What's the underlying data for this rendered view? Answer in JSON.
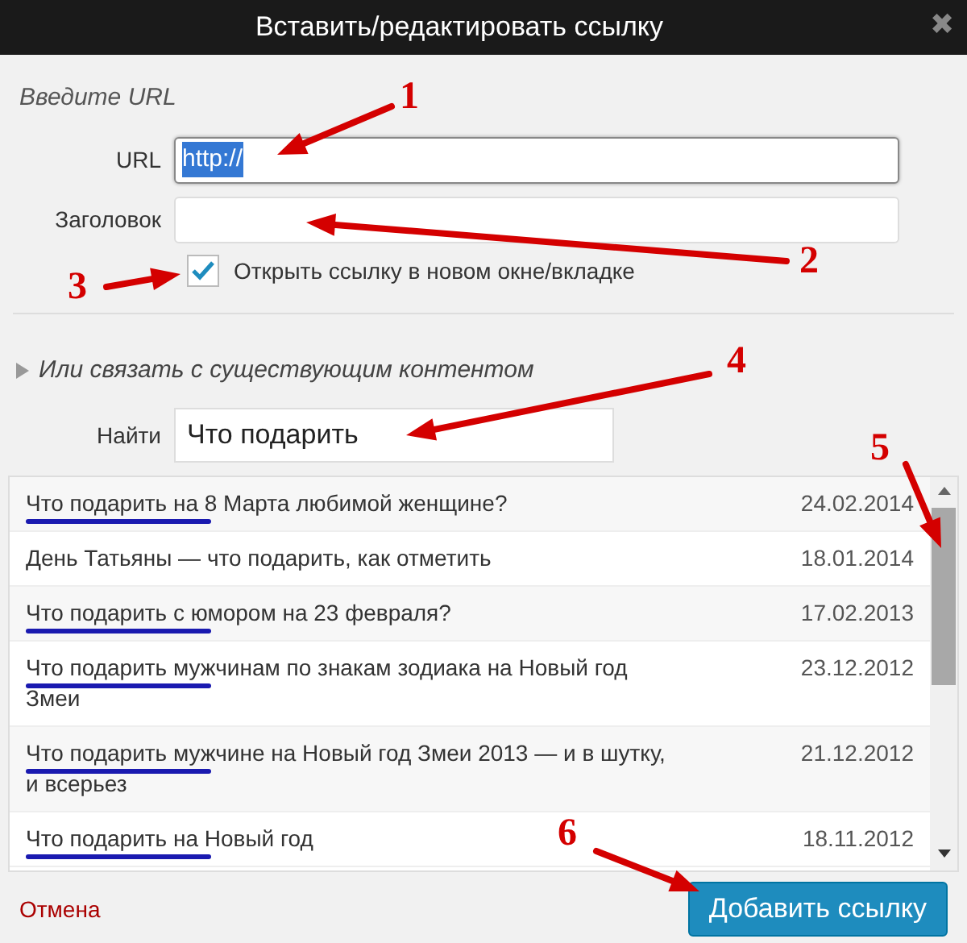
{
  "window": {
    "title": "Вставить/редактировать ссылку",
    "close": "✖"
  },
  "url_section": {
    "heading": "Введите URL",
    "url_label": "URL",
    "url_value": "http://",
    "url_selected": true,
    "title_label": "Заголовок",
    "open_new_tab": {
      "label": "Открыть ссылку в новом окне/вкладке",
      "checked": true
    }
  },
  "existing_content": {
    "toggle": "Или связать с существующим контентом",
    "expanded": true,
    "search_label": "Найти",
    "search_value": "Что подарить"
  },
  "results": [
    {
      "title": "Что подарить на 8 Марта любимой женщине?",
      "date": "24.02.2014",
      "underlined": true
    },
    {
      "title": "День Татьяны — что подарить, как отметить",
      "date": "18.01.2014",
      "underlined": false
    },
    {
      "title": "Что подарить с юмором на 23 февраля?",
      "date": "17.02.2013",
      "underlined": true
    },
    {
      "title": "Что подарить мужчинам по знакам зодиака на Новый год Змеи",
      "date": "23.12.2012",
      "underlined": true
    },
    {
      "title": "Что подарить мужчине на Новый год Змеи 2013 — и в шутку, и всерьез",
      "date": "21.12.2012",
      "underlined": true
    },
    {
      "title": "Что подарить на Новый год",
      "date": "18.11.2012",
      "underlined": true
    }
  ],
  "footer": {
    "cancel": "Отмена",
    "submit": "Добавить ссылку"
  },
  "annotations": [
    {
      "label": "1"
    },
    {
      "label": "2"
    },
    {
      "label": "3"
    },
    {
      "label": "4"
    },
    {
      "label": "5"
    },
    {
      "label": "6"
    }
  ]
}
